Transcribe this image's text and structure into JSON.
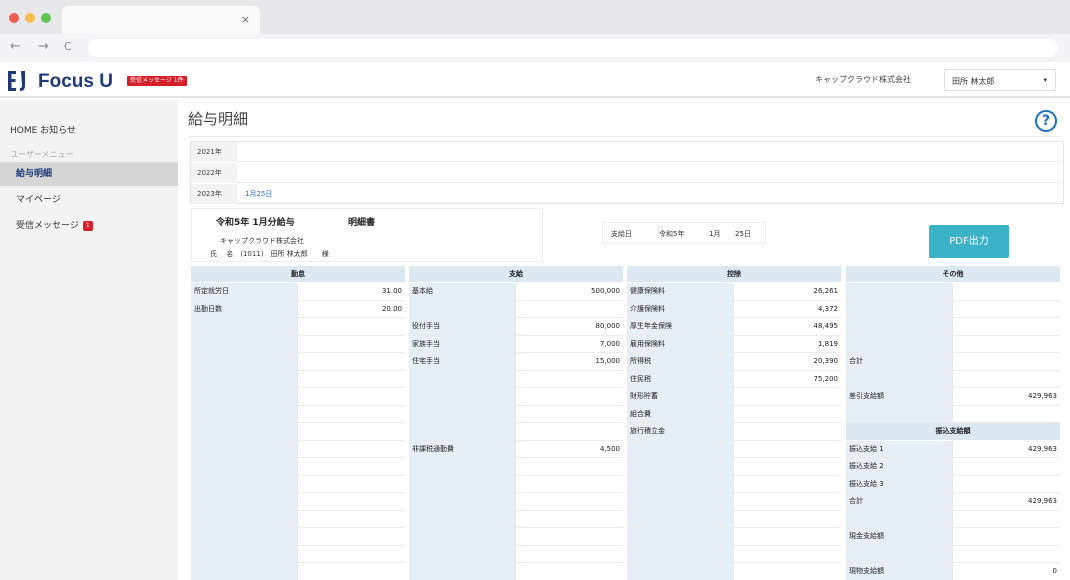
{
  "browser": {
    "tab_close": "×",
    "back": "←",
    "forward": "→",
    "reload": "C"
  },
  "header": {
    "logo_text": "Focus U",
    "badge": "受信メッセージ 1件",
    "company": "キャップクラウド株式会社",
    "user": "田所 林太郎",
    "caret": "▾"
  },
  "sidebar": {
    "home": "HOME お知らせ",
    "section": "ユーザーメニュー",
    "items": [
      {
        "label": "給与明細",
        "active": true
      },
      {
        "label": "マイページ"
      },
      {
        "label": "受信メッセージ",
        "badge": "1"
      }
    ]
  },
  "page": {
    "title": "給与明細",
    "help": "?",
    "years": [
      {
        "label": "2021年",
        "link": ""
      },
      {
        "label": "2022年",
        "link": ""
      },
      {
        "label": "2023年",
        "link": "1月25日"
      }
    ],
    "slip": {
      "title": "令和5年 1月分給与",
      "title2": "明細書",
      "company": "キャップクラウド株式会社",
      "name_line": "氏　 名　(1011)　田所 林太郎　　様"
    },
    "payday": {
      "label": "支給日",
      "era": "令和5年",
      "month": "1月",
      "day": "25日"
    },
    "pdf_button": "PDF出力"
  },
  "tables": {
    "attendance": {
      "header": "勤怠",
      "rows": [
        {
          "label": "所定就労日",
          "value": "31.00"
        },
        {
          "label": "出勤日数",
          "value": "20.00"
        },
        {},
        {},
        {},
        {},
        {},
        {},
        {},
        {},
        {},
        {},
        {},
        {},
        {},
        {},
        {}
      ]
    },
    "payment": {
      "header": "支給",
      "rows": [
        {
          "label": "基本給",
          "value": "500,000"
        },
        {},
        {
          "label": "役付手当",
          "value": "80,000"
        },
        {
          "label": "家族手当",
          "value": "7,000"
        },
        {
          "label": "住宅手当",
          "value": "15,000"
        },
        {},
        {},
        {},
        {},
        {
          "label": "非課税通勤費",
          "value": "4,500"
        },
        {},
        {},
        {},
        {},
        {},
        {},
        {}
      ]
    },
    "deduction": {
      "header": "控除",
      "rows": [
        {
          "label": "健康保険料",
          "value": "26,261"
        },
        {
          "label": "介護保険料",
          "value": "4,372"
        },
        {
          "label": "厚生年金保険",
          "value": "48,495"
        },
        {
          "label": "雇用保険料",
          "value": "1,819"
        },
        {
          "label": "所得税",
          "value": "20,390"
        },
        {
          "label": "住民税",
          "value": "75,200"
        },
        {
          "label": "財形貯蓄",
          "value": ""
        },
        {
          "label": "組合費",
          "value": ""
        },
        {
          "label": "旅行積立金",
          "value": ""
        },
        {},
        {},
        {},
        {},
        {},
        {},
        {},
        {}
      ]
    },
    "other": {
      "header": "その他",
      "rows": [
        {},
        {},
        {},
        {},
        {
          "label": "合計",
          "value": ""
        },
        {},
        {
          "label": "差引支給額",
          "value": "429,963"
        },
        {},
        {
          "header": "振込支給額"
        },
        {
          "label": "振込支給 1",
          "value": "429,963"
        },
        {
          "label": "振込支給 2",
          "value": ""
        },
        {
          "label": "振込支給 3",
          "value": ""
        },
        {
          "label": "合計",
          "value": "429,963"
        },
        {},
        {
          "label": "現金支給額",
          "value": ""
        },
        {},
        {
          "label": "現物支給額",
          "value": "0"
        }
      ]
    }
  },
  "colors": {
    "brand": "#1f3a78",
    "accent": "#3ab3c8",
    "badge": "#d71f2a",
    "table_header": "#dce8f2",
    "link": "#2a6fbf"
  }
}
